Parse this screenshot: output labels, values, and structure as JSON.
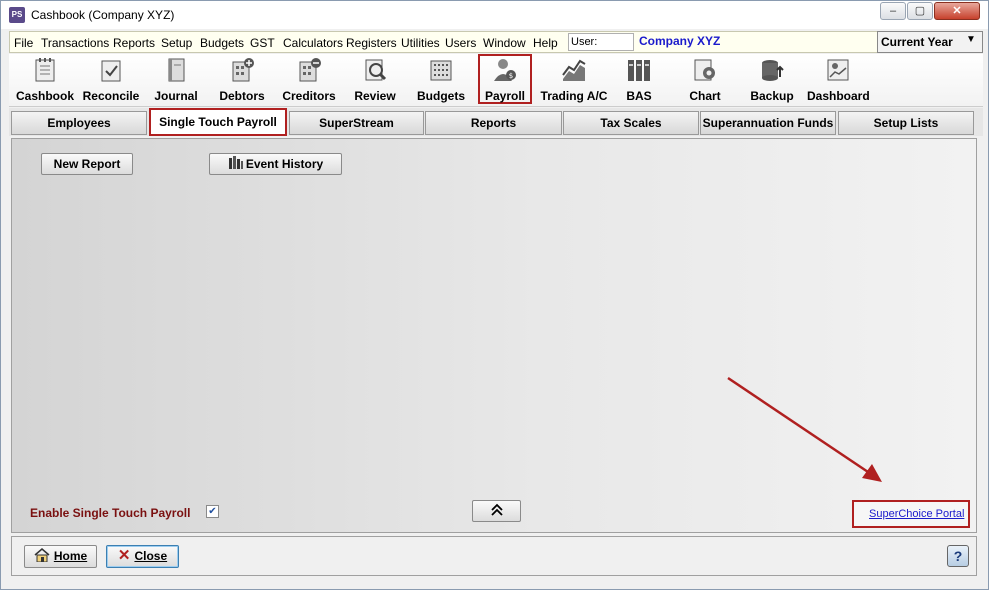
{
  "window": {
    "title": "Cashbook (Company XYZ)",
    "app_icon": "PS"
  },
  "menu": {
    "items": [
      "File",
      "Transactions",
      "Reports",
      "Setup",
      "Budgets",
      "GST",
      "Calculators",
      "Registers",
      "Utilities",
      "Users",
      "Window",
      "Help"
    ],
    "user_label": "User:",
    "company": "Company XYZ",
    "year": "Current Year"
  },
  "toolbar": {
    "items": [
      {
        "label": "Cashbook",
        "icon": "cashbook-icon"
      },
      {
        "label": "Reconcile",
        "icon": "reconcile-icon"
      },
      {
        "label": "Journal",
        "icon": "journal-icon"
      },
      {
        "label": "Debtors",
        "icon": "debtors-icon"
      },
      {
        "label": "Creditors",
        "icon": "creditors-icon"
      },
      {
        "label": "Review",
        "icon": "review-icon"
      },
      {
        "label": "Budgets",
        "icon": "budgets-icon"
      },
      {
        "label": "Payroll",
        "icon": "payroll-icon"
      },
      {
        "label": "Trading A/C",
        "icon": "trading-icon"
      },
      {
        "label": "BAS",
        "icon": "bas-icon"
      },
      {
        "label": "Chart",
        "icon": "chart-icon"
      },
      {
        "label": "Backup",
        "icon": "backup-icon"
      },
      {
        "label": "Dashboard",
        "icon": "dashboard-icon"
      }
    ],
    "active": "Payroll"
  },
  "tabs": {
    "items": [
      "Employees",
      "Single Touch Payroll",
      "SuperStream",
      "Reports",
      "Tax Scales",
      "Superannuation Funds",
      "Setup Lists"
    ],
    "active": "Single Touch Payroll"
  },
  "panel": {
    "new_report": "New Report",
    "event_history": "Event History",
    "enable_stp_label": "Enable Single Touch Payroll",
    "enable_stp_checked": true,
    "collapse_icon": "double-chevron-up-icon",
    "superchoice_link": "SuperChoice Portal"
  },
  "footer": {
    "home": "Home",
    "close": "Close",
    "help_icon": "help-icon"
  },
  "colors": {
    "accent_red": "#b02020",
    "link_blue": "#1a1acc",
    "company_blue": "#1a1acc",
    "stp_label": "#7a1010"
  }
}
